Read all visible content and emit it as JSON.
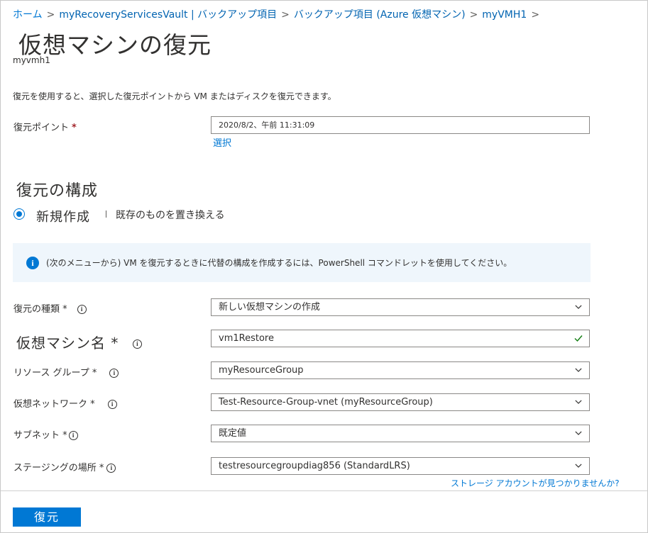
{
  "breadcrumb": {
    "items": [
      "ホーム",
      "myRecoveryServicesVault | バックアップ項目",
      "バックアップ項目 (Azure 仮想マシン)",
      "myVMH1"
    ]
  },
  "page": {
    "title": "仮想マシンの復元",
    "subtitle": "myvmh1",
    "description": "復元を使用すると、選択した復元ポイントから VM またはディスクを復元できます。"
  },
  "restore_point": {
    "label": "復元ポイント",
    "required": "*",
    "value": "2020/8/2、午前 11:31:09",
    "select_link": "選択"
  },
  "config": {
    "title": "復元の構成",
    "option_new": "新規作成",
    "option_replace": "既存のものを置き換える",
    "info_banner": "(次のメニューから) VM を復元するときに代替の構成を作成するには、PowerShell コマンドレットを使用してください。"
  },
  "fields": {
    "restore_type": {
      "label": "復元の種類 *",
      "value": "新しい仮想マシンの作成"
    },
    "vm_name": {
      "label": "仮想マシン名 *",
      "value": "vm1Restore"
    },
    "resource_group": {
      "label": "リソース グループ *",
      "value": "myResourceGroup"
    },
    "virtual_network": {
      "label": "仮想ネットワーク *",
      "value": "Test-Resource-Group-vnet (myResourceGroup)"
    },
    "subnet": {
      "label": "サブネット *",
      "value": "既定値"
    },
    "staging_location": {
      "label": "ステージングの場所 *",
      "value": "testresourcegroupdiag856 (StandardLRS)"
    }
  },
  "storage_link": "ストレージ アカウントが見つかりませんか?",
  "footer": {
    "restore_button": "復元"
  },
  "colors": {
    "accent": "#0078d4",
    "required": "#a4262c",
    "banner_bg": "#eff6fc",
    "success": "#107c10"
  },
  "icons": [
    "info-icon",
    "chevron-down-icon",
    "checkmark-icon",
    "breadcrumb-chevron-icon"
  ]
}
